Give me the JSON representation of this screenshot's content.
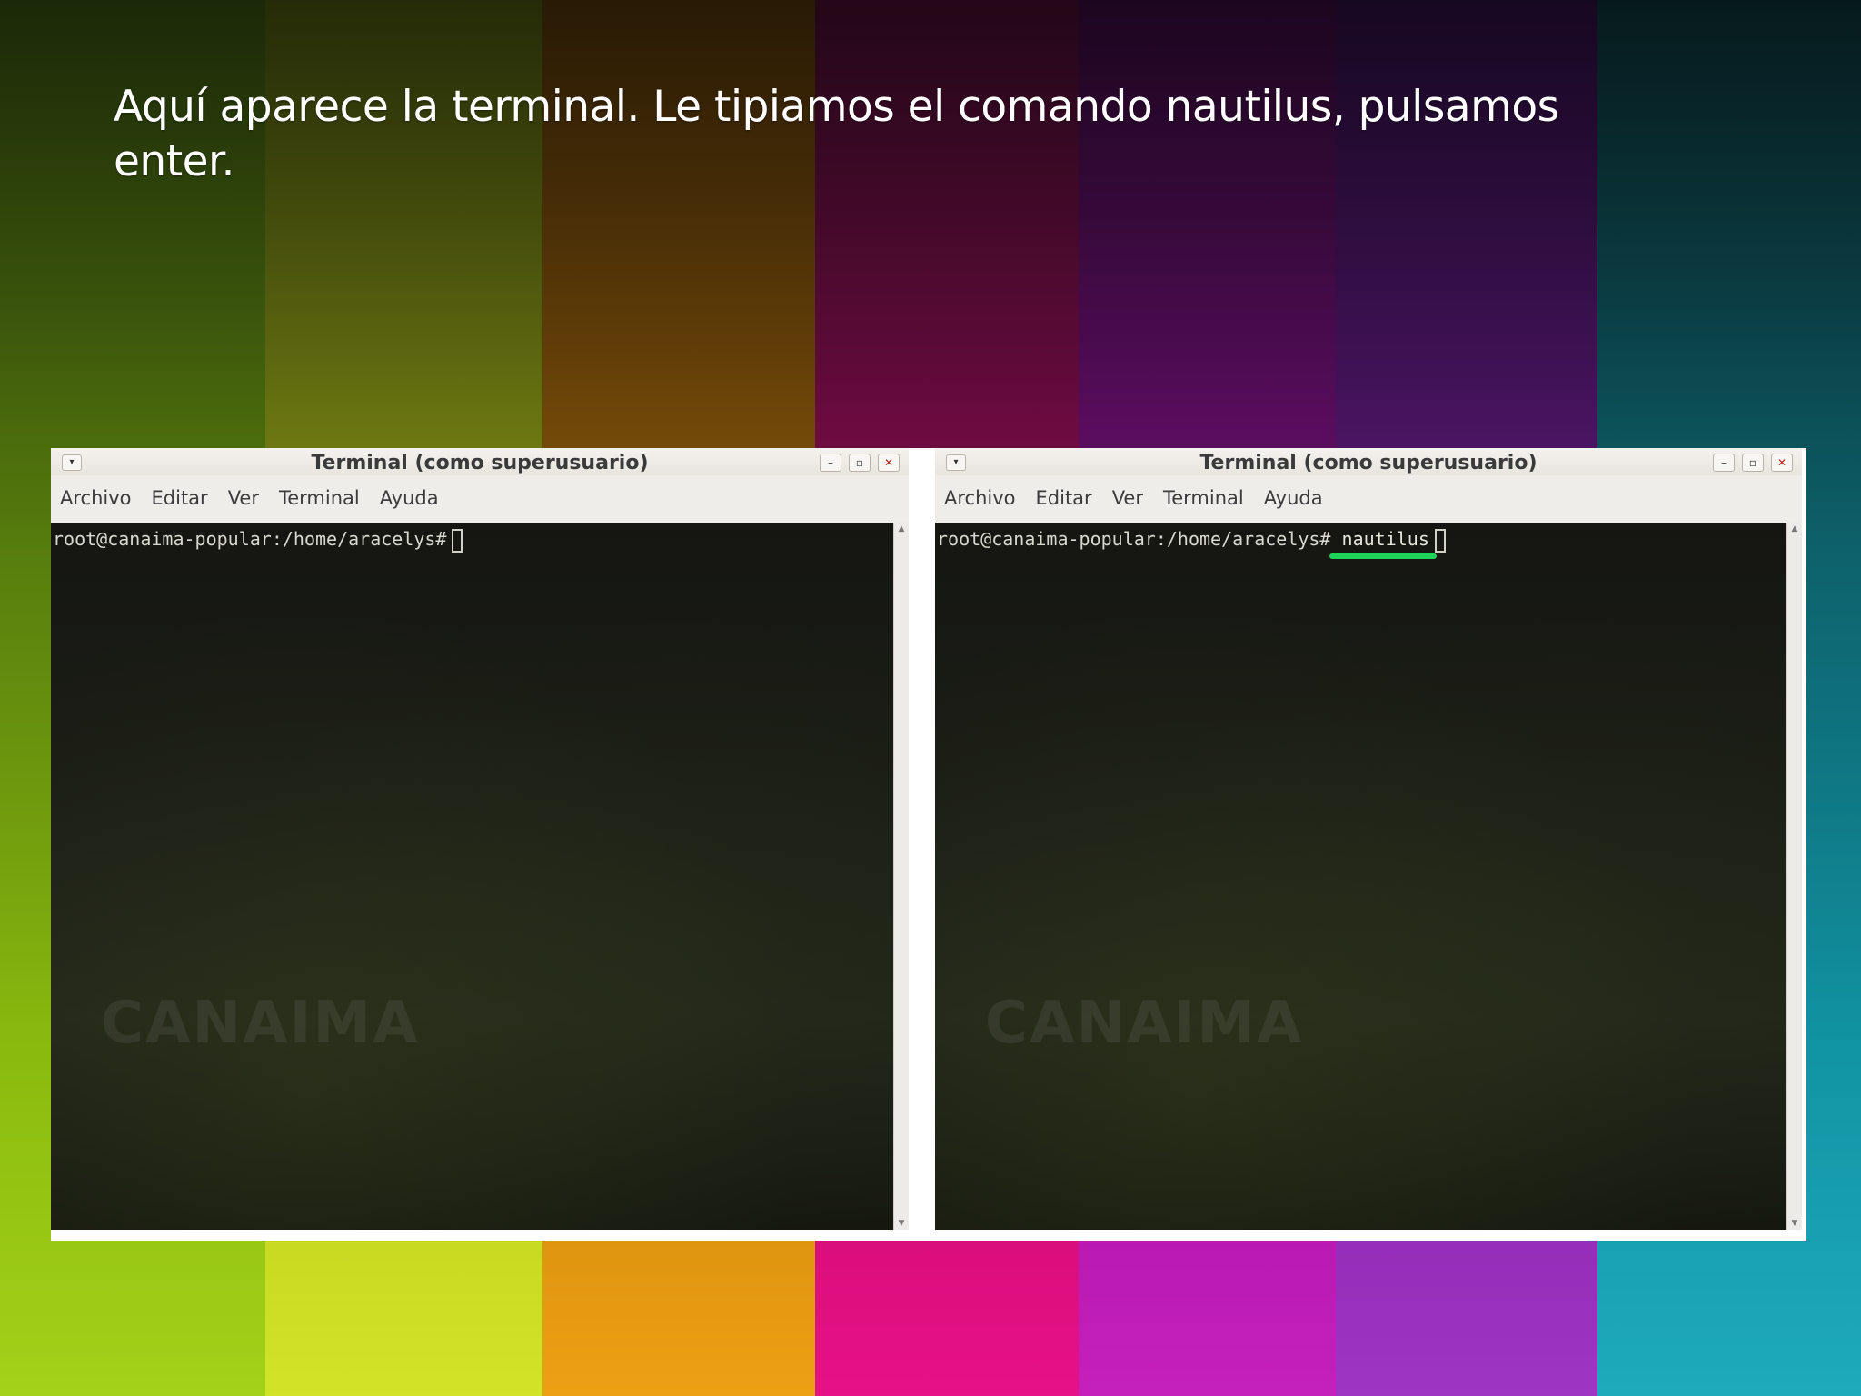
{
  "slide": {
    "caption": "Aquí aparece la terminal. Le  tipiamos el comando nautilus, pulsamos enter."
  },
  "colors": {
    "stripes": [
      "#9fcf0d",
      "#d0e21c",
      "#eb9b08",
      "#e6057f",
      "#c214b7",
      "#9a2ac0",
      "#12a6b8"
    ],
    "highlight": "#1fd25a",
    "pointer": "#3fc07a"
  },
  "terminals": [
    {
      "title": "Terminal (como superusuario)",
      "menu": [
        "Archivo",
        "Editar",
        "Ver",
        "Terminal",
        "Ayuda"
      ],
      "prompt": "root@canaima-popular:/home/aracelys#",
      "command": "",
      "watermark": "CANAIMA"
    },
    {
      "title": "Terminal (como superusuario)",
      "menu": [
        "Archivo",
        "Editar",
        "Ver",
        "Terminal",
        "Ayuda"
      ],
      "prompt": "root@canaima-popular:/home/aracelys#",
      "command": "nautilus",
      "watermark": "CANAIMA"
    }
  ],
  "window_controls": {
    "menu_icon": "chevron-down-icon",
    "minimize": "minimize-icon",
    "maximize": "maximize-icon",
    "close": "close-icon"
  }
}
